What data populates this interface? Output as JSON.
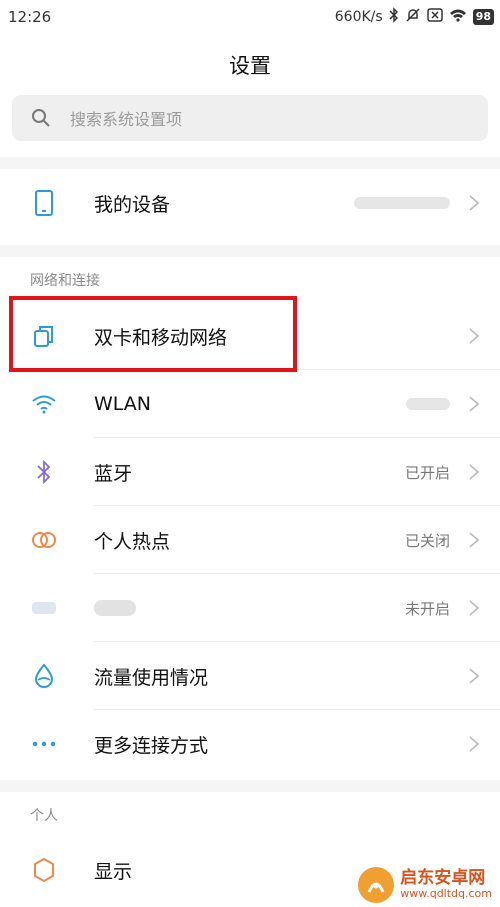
{
  "status_bar": {
    "time": "12:26",
    "speed": "660K/s",
    "battery": "98"
  },
  "title": "设置",
  "search": {
    "placeholder": "搜索系统设置项"
  },
  "my_device": {
    "label": "我的设备"
  },
  "section_network": {
    "header": "网络和连接"
  },
  "network_items": [
    {
      "label": "双卡和移动网络",
      "value": ""
    },
    {
      "label": "WLAN",
      "value": ""
    },
    {
      "label": "蓝牙",
      "value": "已开启"
    },
    {
      "label": "个人热点",
      "value": "已关闭"
    },
    {
      "label": "",
      "value": "未开启"
    },
    {
      "label": "流量使用情况",
      "value": ""
    },
    {
      "label": "更多连接方式",
      "value": ""
    }
  ],
  "section_personal": {
    "header": "个人"
  },
  "personal_items": [
    {
      "label": "显示",
      "value": ""
    }
  ],
  "watermark": {
    "name": "启东安卓网",
    "url": "www.qdltdq.com"
  },
  "colors": {
    "accent": "#2d9bd6",
    "highlight": "#e2141a",
    "hotspot": "#f08a4b",
    "display": "#f08a4b"
  }
}
